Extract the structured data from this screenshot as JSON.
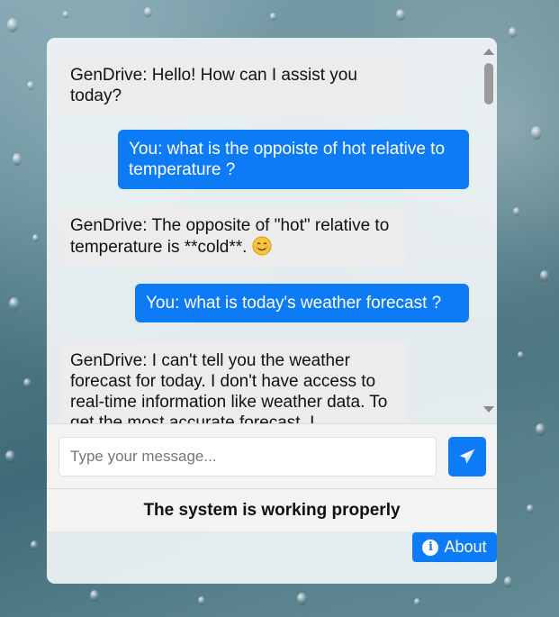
{
  "chat": {
    "messages": [
      {
        "sender": "bot",
        "text": "GenDrive: Hello! How can I assist you today?"
      },
      {
        "sender": "user",
        "text": "You: what is the oppoiste of hot relative to temperature ?"
      },
      {
        "sender": "bot",
        "text": "GenDrive: The opposite of \"hot\" relative to temperature is **cold**.",
        "emoji": "smiling-face-icon"
      },
      {
        "sender": "user",
        "text": "You: what is today's weather forecast ?"
      },
      {
        "sender": "bot",
        "text": "GenDrive: I can't tell you the weather forecast for today. I don't have access to real-time information like weather data. To get the most accurate forecast, I"
      }
    ]
  },
  "input": {
    "placeholder": "Type your message...",
    "send_icon": "paper-plane-icon"
  },
  "status": {
    "text": "The system is working properly"
  },
  "about": {
    "label": "About",
    "icon": "info-icon"
  },
  "colors": {
    "accent": "#0d7bf5",
    "bot_bubble": "#ececec"
  }
}
